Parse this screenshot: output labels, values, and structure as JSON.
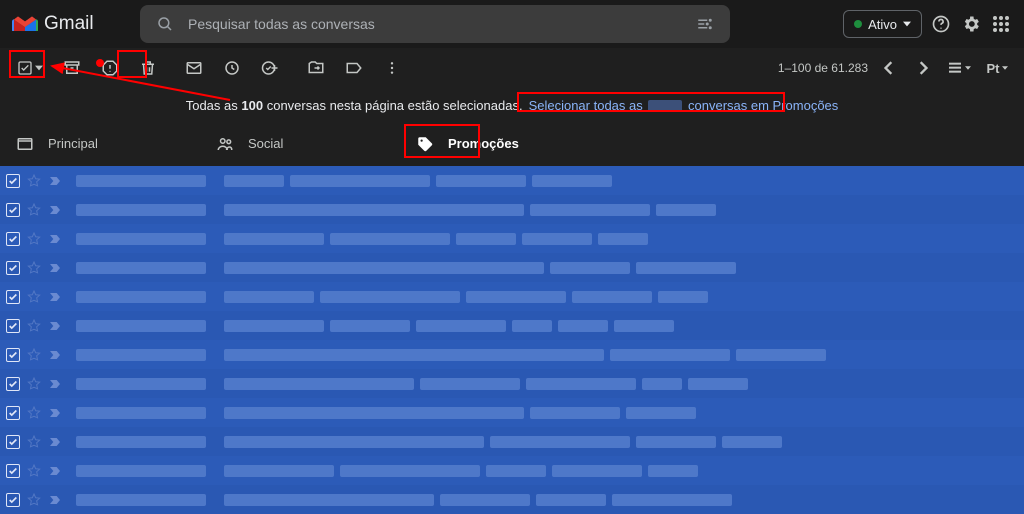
{
  "header": {
    "product": "Gmail",
    "search_placeholder": "Pesquisar todas as conversas",
    "status_label": "Ativo"
  },
  "toolbar": {
    "pager_text": "1–100 de 61.283",
    "split_label": "Pt"
  },
  "selection_banner": {
    "text_pre": "Todas as",
    "count": "100",
    "text_mid": "conversas nesta página estão selecionadas.",
    "link_pre": "Selecionar todas as",
    "link_blank": "      ",
    "link_post": "conversas em Promoções"
  },
  "tabs": [
    {
      "key": "primary",
      "label": "Principal"
    },
    {
      "key": "social",
      "label": "Social"
    },
    {
      "key": "promotions",
      "label": "Promoções"
    }
  ],
  "rows": [
    {
      "widths": [
        60,
        140,
        90,
        80
      ]
    },
    {
      "widths": [
        300,
        120,
        60
      ]
    },
    {
      "widths": [
        100,
        120,
        60,
        70,
        50
      ]
    },
    {
      "widths": [
        320,
        80,
        100
      ]
    },
    {
      "widths": [
        90,
        140,
        100,
        80,
        50
      ]
    },
    {
      "widths": [
        100,
        80,
        90,
        40,
        50,
        60
      ]
    },
    {
      "widths": [
        380,
        120,
        90
      ]
    },
    {
      "widths": [
        190,
        100,
        110,
        40,
        60
      ]
    },
    {
      "widths": [
        300,
        90,
        70
      ]
    },
    {
      "widths": [
        260,
        140,
        80,
        60
      ]
    },
    {
      "widths": [
        110,
        140,
        60,
        90,
        50
      ]
    },
    {
      "widths": [
        210,
        90,
        70,
        120
      ]
    }
  ]
}
